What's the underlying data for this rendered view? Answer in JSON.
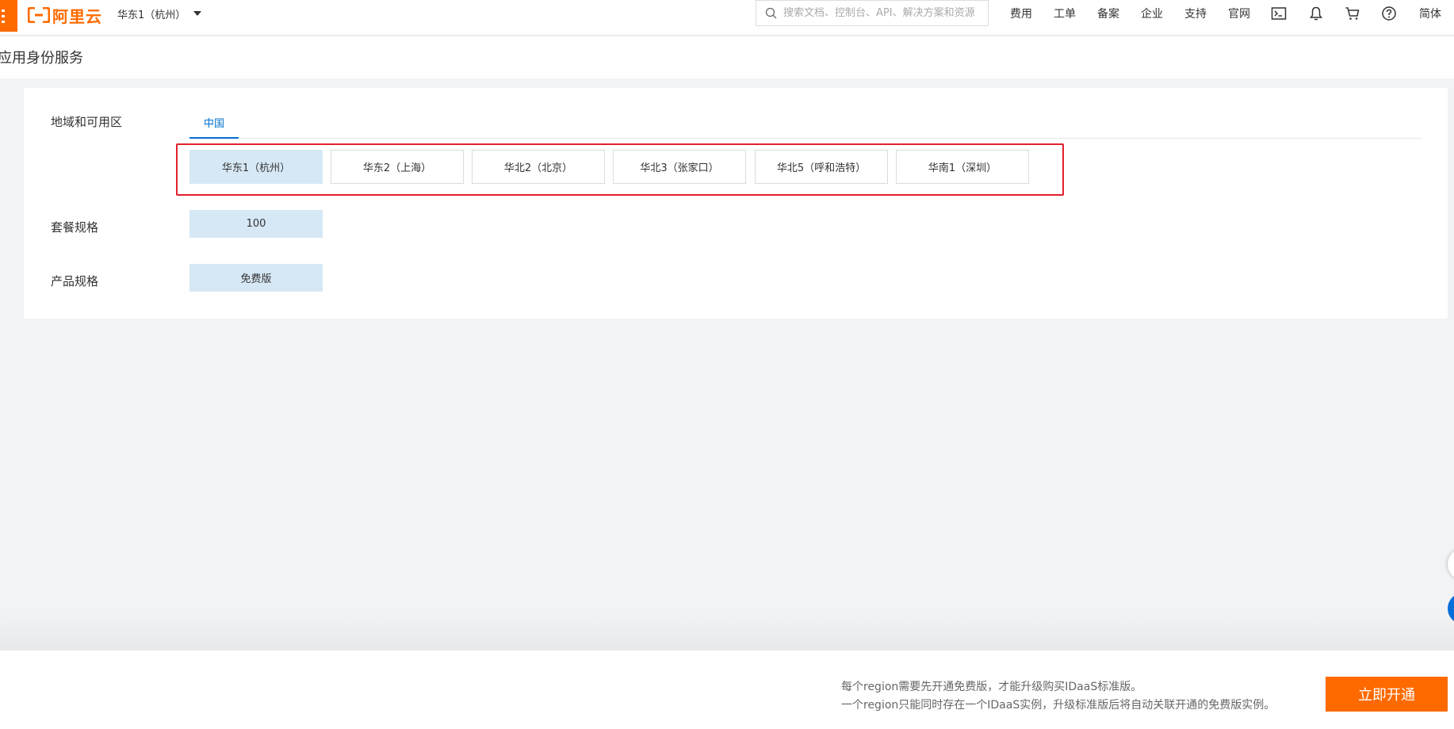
{
  "header": {
    "logo_text": "阿里云",
    "region": "华东1（杭州）",
    "search_placeholder": "搜索文档、控制台、API、解决方案和资源",
    "nav": [
      "费用",
      "工单",
      "备案",
      "企业",
      "支持",
      "官网"
    ],
    "icons": [
      "terminal-icon",
      "bell-icon",
      "cart-icon",
      "help-icon"
    ],
    "language": "简体"
  },
  "page": {
    "title": "应用身份服务"
  },
  "form": {
    "region_label": "地域和可用区",
    "tab": "中国",
    "regions": [
      "华东1（杭州）",
      "华东2（上海）",
      "华北2（北京）",
      "华北3（张家口）",
      "华北5（呼和浩特）",
      "华南1（深圳）"
    ],
    "selected_region_index": 0,
    "package_label": "套餐规格",
    "package_value": "100",
    "product_label": "产品规格",
    "product_value": "免费版"
  },
  "footer": {
    "note_1": "每个region需要先开通免费版，才能升级购买IDaaS标准版。",
    "note_2": "一个region只能同时存在一个IDaaS实例，升级标准版后将自动关联开通的免费版实例。",
    "activate_label": "立即开通"
  },
  "colors": {
    "brand": "#ff6a00",
    "link": "#0070cc",
    "selected_bg": "#d6e8f5",
    "highlight": "#e5202e"
  }
}
